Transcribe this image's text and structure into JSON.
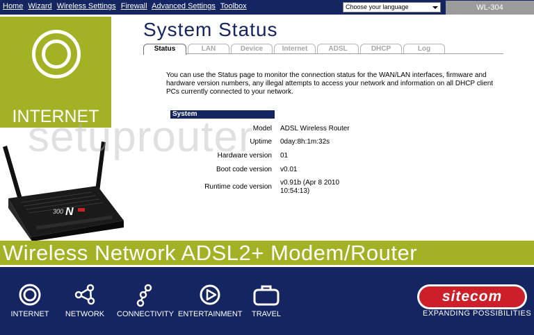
{
  "topnav": {
    "links": [
      "Home",
      "Wizard",
      "Wireless Settings",
      "Firewall",
      "Advanced Settings",
      "Toolbox"
    ],
    "language_select": "Choose your language",
    "model": "WL-304"
  },
  "sidebar": {
    "internet_label": "INTERNET",
    "watermark": "setuprouter"
  },
  "main": {
    "title": "System Status",
    "tabs": [
      "Status",
      "LAN",
      "Device",
      "Internet",
      "ADSL",
      "DHCP",
      "Log"
    ],
    "active_tab": "Status",
    "description": "You can use the Status page to monitor the connection status for the WAN/LAN interfaces, firmware and hardware version numbers, any illegal attempts to access your network and information on all DHCP client PCs currently connected to your network.",
    "system_header": "System",
    "system_rows": [
      {
        "label": "Model",
        "value": "ADSL Wireless Router"
      },
      {
        "label": "Uptime",
        "value": "0day:8h:1m:32s"
      },
      {
        "label": "Hardware version",
        "value": "01"
      },
      {
        "label": "Boot code version",
        "value": "v0.01"
      },
      {
        "label": "Runtime code version",
        "value": "v0.91b (Apr 8 2010 10:54:13)"
      }
    ]
  },
  "banner": {
    "text": "Wireless Network ADSL2+ Modem/Router"
  },
  "footer": {
    "items": [
      {
        "label": "INTERNET",
        "icon": "internet-icon"
      },
      {
        "label": "NETWORK",
        "icon": "network-icon"
      },
      {
        "label": "CONNECTIVITY",
        "icon": "connectivity-icon"
      },
      {
        "label": "ENTERTAINMENT",
        "icon": "entertainment-icon"
      },
      {
        "label": "TRAVEL",
        "icon": "travel-icon"
      }
    ],
    "brand": "sitecom",
    "tagline": "EXPANDING POSSIBILITIES"
  },
  "colors": {
    "navy": "#142562",
    "green": "#a3b225",
    "sitecom_red": "#cc1f2a"
  }
}
